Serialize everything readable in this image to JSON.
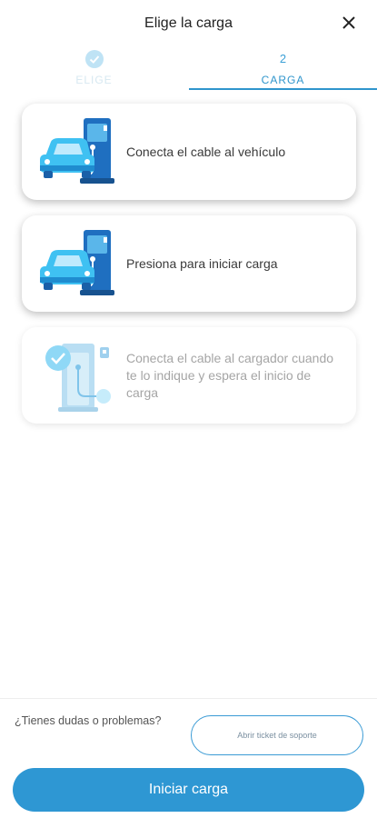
{
  "header": {
    "title": "Elige la carga",
    "close_icon": "close-icon"
  },
  "steps": [
    {
      "number": "",
      "label": "ELIGE",
      "state": "done",
      "icon": "check-circle-icon"
    },
    {
      "number": "2",
      "label": "CARGA",
      "state": "active"
    }
  ],
  "cards": [
    {
      "text": "Conecta el cable al vehículo",
      "icon": "car-charger-icon",
      "state": "active"
    },
    {
      "text": "Presiona para iniciar carga",
      "icon": "car-charger-icon",
      "state": "active"
    },
    {
      "text": "Conecta el cable al cargador cuando te lo indique y espera el inicio de carga",
      "icon": "charger-done-icon",
      "state": "done"
    }
  ],
  "footer": {
    "question": "¿Tienes dudas o problemas?",
    "ticket_button": "Abrir ticket de soporte",
    "start_button": "Iniciar carga"
  },
  "colors": {
    "accent": "#2e97d3",
    "car": "#3fc1f2",
    "charger": "#1f6fc0"
  }
}
